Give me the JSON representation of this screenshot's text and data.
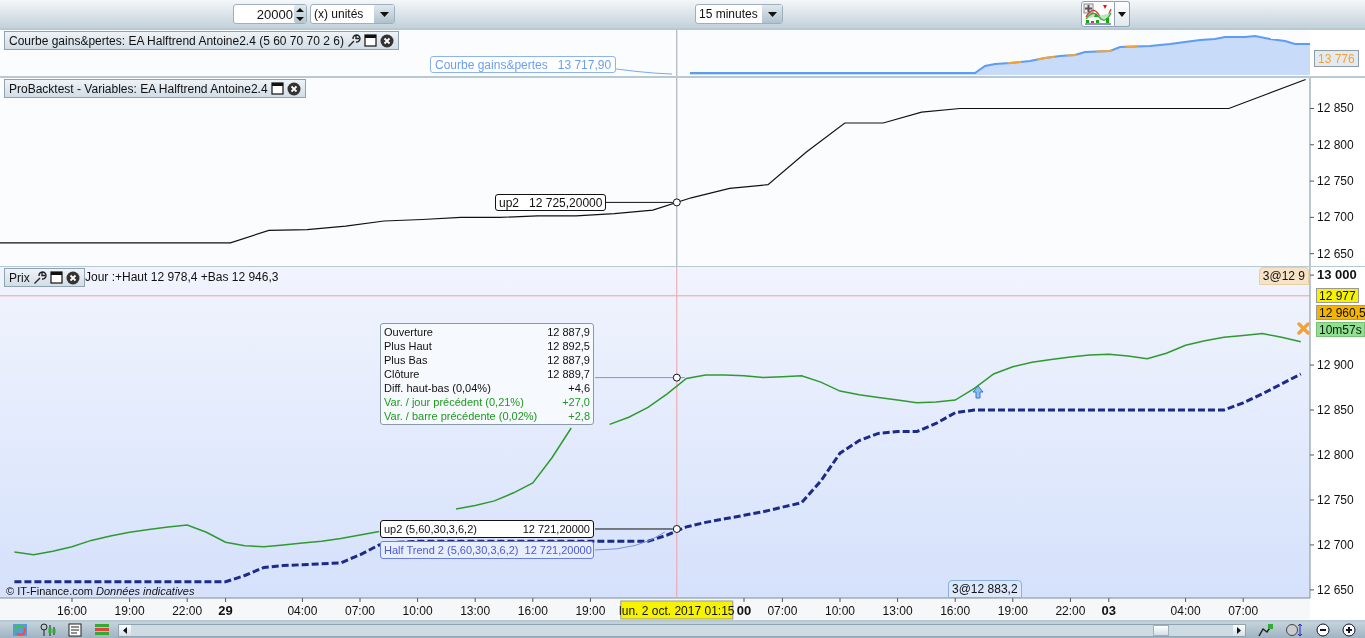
{
  "toolbar": {
    "quantity": "20000",
    "unit": "(x) unités",
    "timeframe": "15 minutes"
  },
  "equity_panel": {
    "title": "Courbe gains&pertes: EA Halftrend Antoine2.4 (5 60 70 70 2 6)",
    "tooltip_label": "Courbe gains&pertes",
    "tooltip_value": "13 717,90",
    "last_value": "13 776"
  },
  "variables_panel": {
    "title": "ProBacktest - Variables: EA Halftrend Antoine2.4",
    "cursor_label": "up2",
    "cursor_value": "12 725,20000",
    "chart_data": {
      "type": "line",
      "ylim": [
        12633,
        12892
      ],
      "yticks": [
        {
          "value": 12650,
          "label": "12 650"
        },
        {
          "value": 12700,
          "label": "12 700"
        },
        {
          "value": 12750,
          "label": "12 750"
        },
        {
          "value": 12800,
          "label": "12 800"
        },
        {
          "value": 12850,
          "label": "12 850"
        }
      ],
      "series": [
        {
          "color": "#111111",
          "values": [
            12665,
            12665,
            12665,
            12665,
            12665,
            12665,
            12665,
            12682,
            12683,
            12688,
            12695,
            12697,
            12700,
            12700,
            12702,
            12702,
            12705,
            12710,
            12727,
            12740,
            12745,
            12790,
            12830,
            12830,
            12845,
            12850,
            12850,
            12850,
            12850,
            12850,
            12850,
            12850,
            12850,
            12870,
            12890
          ]
        }
      ]
    }
  },
  "price_panel": {
    "title": "Prix",
    "day_info": "Jour :+Haut 12 978,4 +Bas 12 946,3",
    "ohlc": [
      {
        "label": "Ouverture",
        "value": "12 887,9",
        "kind": "plain"
      },
      {
        "label": "Plus Haut",
        "value": "12 892,5",
        "kind": "plain"
      },
      {
        "label": "Plus Bas",
        "value": "12 887,9",
        "kind": "plain"
      },
      {
        "label": "Clôture",
        "value": "12 889,7",
        "kind": "plain"
      },
      {
        "label": "Diff. haut-bas (0,04%)",
        "value": "+4,6",
        "kind": "plain"
      },
      {
        "label": "Var. / jour précédent (0,21%)",
        "value": "+27,0",
        "kind": "change"
      },
      {
        "label": "Var. / barre précédente (0,02%)",
        "value": "+2,8",
        "kind": "change"
      }
    ],
    "indicator_labels": [
      {
        "name": "up2 (5,60,30,3,6,2)",
        "value": "12 721,20000",
        "kind": "variable"
      },
      {
        "name": "Half Trend 2 (5,60,30,3,6,2)",
        "value": "12 721,20000",
        "kind": "indicator"
      }
    ],
    "order_labels": [
      {
        "text": "3@12 9",
        "kind": "top"
      },
      {
        "text": "3@12 883,2",
        "kind": "bottom"
      }
    ],
    "price_tags": [
      {
        "text": "12 977",
        "kind": "last"
      },
      {
        "text": "12 960,5",
        "kind": "position"
      },
      {
        "text": "10m57s",
        "kind": "countdown"
      }
    ],
    "copyright": "© IT-Finance.com *Données indicatives*",
    "cursor_time": "lun. 2 oct. 2017 01:15",
    "chart_data": {
      "type": "line",
      "categories": [
        null,
        null,
        null,
        "16:00",
        null,
        null,
        "19:00",
        null,
        null,
        "22:00",
        null,
        "29",
        null,
        null,
        null,
        "04:00",
        null,
        null,
        "07:00",
        null,
        null,
        "10:00",
        null,
        null,
        "13:00",
        null,
        null,
        "16:00",
        null,
        null,
        "19:00",
        null,
        null,
        null,
        null,
        null,
        null,
        null,
        "00",
        null,
        "07:00",
        null,
        null,
        "10:00",
        null,
        null,
        "13:00",
        null,
        null,
        "16:00",
        null,
        null,
        "19:00",
        null,
        null,
        "22:00",
        null,
        "03",
        null,
        null,
        null,
        "04:00",
        null,
        null,
        "07:00",
        null,
        null,
        null
      ],
      "ylim": [
        12641,
        13009
      ],
      "ref_lines": [
        {
          "axis": "y",
          "value": 12977,
          "color": "#f0a0a8"
        }
      ],
      "yticks": [
        {
          "value": 12650,
          "label": "12 650"
        },
        {
          "value": 12700,
          "label": "12 700"
        },
        {
          "value": 12750,
          "label": "12 750"
        },
        {
          "value": 12800,
          "label": "12 800"
        },
        {
          "value": 12850,
          "label": "12 850"
        },
        {
          "value": 12900,
          "label": "12 900"
        },
        {
          "value": 13000,
          "label": "13 000"
        }
      ],
      "series": [
        {
          "color": "#2f9a2f",
          "values": [
            12692,
            12689,
            12693,
            12698,
            12705,
            12710,
            12714,
            12717,
            12720,
            12722,
            12714,
            12703,
            12699,
            12698,
            12700,
            12702,
            12704,
            12707,
            12711,
            12715,
            null,
            null,
            null,
            12740,
            12744,
            12749,
            12758,
            12769,
            12797,
            12830,
            null,
            12834,
            12842,
            12853,
            12868,
            12885,
            12889,
            12889,
            12888,
            12886,
            12887,
            12888,
            12881,
            12871,
            12867,
            12864,
            12861,
            12858,
            12859,
            12861,
            12874,
            12890,
            12898,
            12903,
            12906,
            12909,
            12911,
            12912,
            12910,
            12907,
            12913,
            12922,
            12927,
            12931,
            12933,
            12935,
            12931,
            12926
          ]
        },
        {
          "color": "#1c2a8c",
          "line_style": "dashed",
          "values": [
            12659,
            12659,
            12659,
            12659,
            12659,
            12659,
            12659,
            12659,
            12659,
            12659,
            12659,
            12659,
            12666,
            12675,
            12677,
            12678,
            12679,
            12680,
            12689,
            12700,
            12703,
            12704,
            12704,
            12704,
            12704,
            12704,
            12704,
            12704,
            12704,
            12704,
            12704,
            12704,
            12704,
            12704,
            12711,
            12720,
            12725,
            12729,
            12733,
            12737,
            12742,
            12747,
            12771,
            12802,
            12816,
            12824,
            12826,
            12826,
            12835,
            12847,
            12850,
            12850,
            12850,
            12850,
            12850,
            12850,
            12850,
            12850,
            12850,
            12850,
            12850,
            12850,
            12850,
            12850,
            12858,
            12868,
            12879,
            12890
          ]
        }
      ]
    }
  }
}
